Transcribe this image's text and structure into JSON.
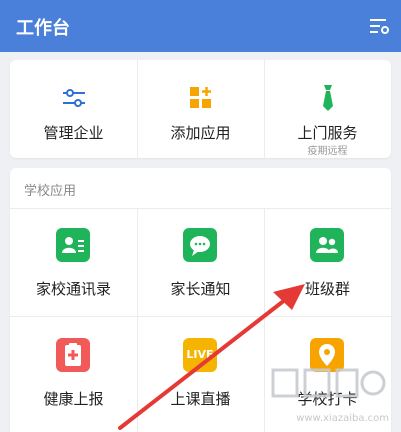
{
  "header": {
    "title": "工作台"
  },
  "quick": [
    {
      "label": "管理企业",
      "sub": ""
    },
    {
      "label": "添加应用",
      "sub": ""
    },
    {
      "label": "上门服务",
      "sub": "疫期远程"
    }
  ],
  "school": {
    "section_title": "学校应用",
    "apps": [
      {
        "label": "家校通讯录"
      },
      {
        "label": "家长通知"
      },
      {
        "label": "班级群"
      },
      {
        "label": "健康上报"
      },
      {
        "label": "上课直播"
      },
      {
        "label": "学校打卡"
      }
    ],
    "live_badge": "LIVE"
  },
  "watermark": {
    "text": "www.xiazaiba.com"
  },
  "colors": {
    "header": "#4a80d9",
    "icon_blue": "#2f6fd6",
    "icon_orange": "#f7a400",
    "icon_green": "#1fb45a",
    "icon_red": "#f25a5a",
    "arrow": "#e53935"
  }
}
